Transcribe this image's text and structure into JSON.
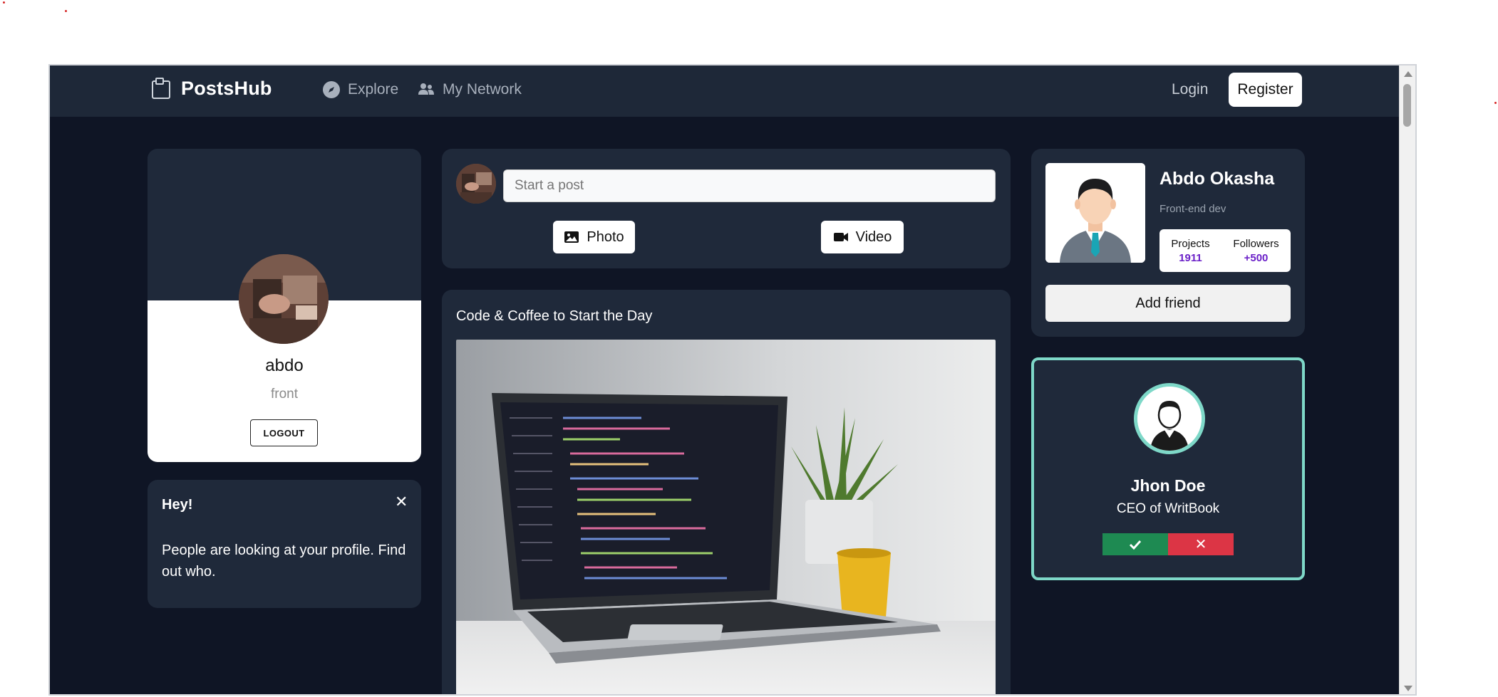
{
  "navbar": {
    "brand": "PostsHub",
    "links": [
      {
        "label": "Explore",
        "icon": "compass-icon"
      },
      {
        "label": "My Network",
        "icon": "users-icon"
      }
    ],
    "login_label": "Login",
    "register_label": "Register"
  },
  "profile": {
    "name": "abdo",
    "role": "front",
    "logout_label": "LOGOUT"
  },
  "notice": {
    "title": "Hey!",
    "close_symbol": "✕",
    "text": "People are looking at your profile. Find out who."
  },
  "composer": {
    "placeholder": "Start a post",
    "photo_label": "Photo",
    "video_label": "Video"
  },
  "post": {
    "title": "Code & Coffee to Start the Day"
  },
  "suggested_profile": {
    "name": "Abdo Okasha",
    "title": "Front-end dev",
    "stats": [
      {
        "label": "Projects",
        "value": "1911"
      },
      {
        "label": "Followers",
        "value": "+500"
      }
    ],
    "add_friend_label": "Add friend"
  },
  "friend_request": {
    "name": "Jhon Doe",
    "role": "CEO of WritBook",
    "reject_symbol": "✕"
  },
  "colors": {
    "page_bg": "#0f1525",
    "card_bg": "#1f293a",
    "navbar_bg": "#1e2838",
    "accent_teal": "#7ed8c8",
    "accept_green": "#1e8a52",
    "reject_red": "#dc3545",
    "stat_purple": "#6b21c8"
  }
}
